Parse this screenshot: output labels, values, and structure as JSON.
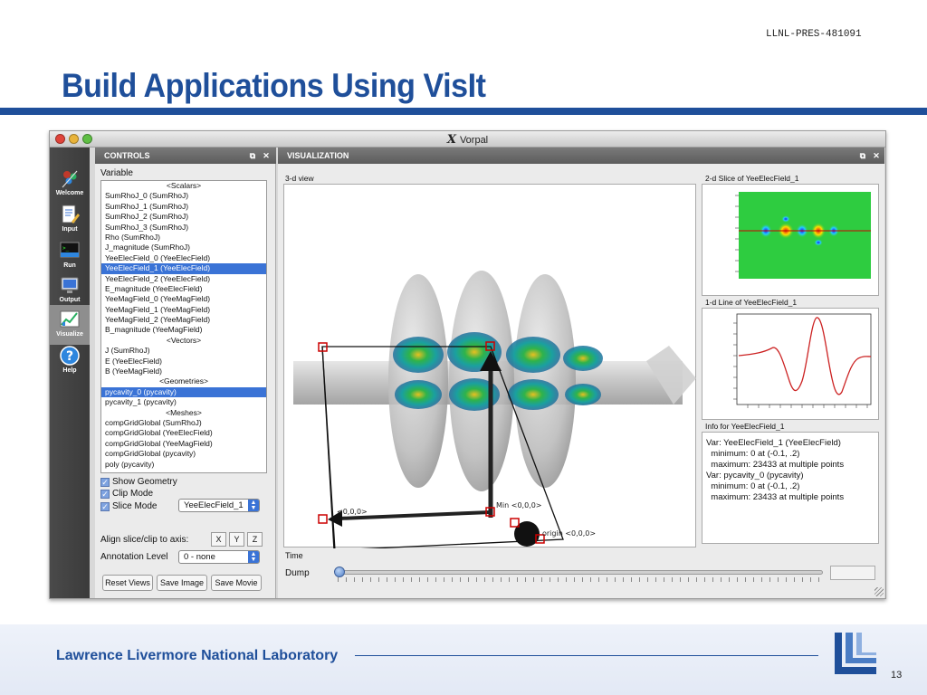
{
  "slide": {
    "pres_id": "LLNL-PRES-481091",
    "title": "Build Applications Using VisIt",
    "footer_org": "Lawrence Livermore National Laboratory",
    "page_number": "13"
  },
  "window": {
    "title": "Vorpal",
    "title_icon": "X"
  },
  "nav": {
    "items": [
      {
        "label": "Welcome",
        "icon": "welcome-icon"
      },
      {
        "label": "Input",
        "icon": "input-icon"
      },
      {
        "label": "Run",
        "icon": "run-icon"
      },
      {
        "label": "Output",
        "icon": "output-icon"
      },
      {
        "label": "Visualize",
        "icon": "visualize-icon",
        "active": true
      },
      {
        "label": "Help",
        "icon": "help-icon"
      }
    ]
  },
  "controls": {
    "header": "CONTROLS",
    "variable_label": "Variable",
    "variables": [
      {
        "text": "<Scalars>",
        "header": true
      },
      {
        "text": "SumRhoJ_0 (SumRhoJ)"
      },
      {
        "text": "SumRhoJ_1 (SumRhoJ)"
      },
      {
        "text": "SumRhoJ_2 (SumRhoJ)"
      },
      {
        "text": "SumRhoJ_3 (SumRhoJ)"
      },
      {
        "text": "Rho (SumRhoJ)"
      },
      {
        "text": "J_magnitude (SumRhoJ)"
      },
      {
        "text": "YeeElecField_0 (YeeElecField)"
      },
      {
        "text": "YeeElecField_1 (YeeElecField)",
        "selected": true
      },
      {
        "text": "YeeElecField_2 (YeeElecField)"
      },
      {
        "text": "E_magnitude (YeeElecField)"
      },
      {
        "text": "YeeMagField_0 (YeeMagField)"
      },
      {
        "text": "YeeMagField_1 (YeeMagField)"
      },
      {
        "text": "YeeMagField_2 (YeeMagField)"
      },
      {
        "text": "B_magnitude (YeeMagField)"
      },
      {
        "text": "<Vectors>",
        "header": true
      },
      {
        "text": "J (SumRhoJ)"
      },
      {
        "text": "E (YeeElecField)"
      },
      {
        "text": "B (YeeMagField)"
      },
      {
        "text": "<Geometries>",
        "header": true
      },
      {
        "text": "pycavity_0 (pycavity)",
        "selected": true
      },
      {
        "text": "pycavity_1 (pycavity)"
      },
      {
        "text": "<Meshes>",
        "header": true
      },
      {
        "text": "compGridGlobal (SumRhoJ)"
      },
      {
        "text": "compGridGlobal (YeeElecField)"
      },
      {
        "text": "compGridGlobal (YeeMagField)"
      },
      {
        "text": "compGridGlobal (pycavity)"
      },
      {
        "text": "poly (pycavity)"
      }
    ],
    "show_geometry": {
      "label": "Show Geometry",
      "checked": true
    },
    "clip_mode": {
      "label": "Clip Mode",
      "checked": true
    },
    "slice_mode": {
      "label": "Slice Mode",
      "checked": true,
      "value": "YeeElecField_1"
    },
    "align_label": "Align slice/clip to axis:",
    "axes": [
      "X",
      "Y",
      "Z"
    ],
    "annotation_label": "Annotation Level",
    "annotation_value": "0 - none",
    "buttons": {
      "reset": "Reset Views",
      "save_image": "Save Image",
      "save_movie": "Save Movie"
    }
  },
  "visualization": {
    "header": "VISUALIZATION",
    "view3d_label": "3-d view",
    "markers": {
      "min_y": "Min <0,0,0>",
      "min_x": "<0,0,0>",
      "origin": "origin <0,0,0>"
    },
    "slice_label": "2-d Slice of YeeElecField_1",
    "line_label": "1-d Line of YeeElecField_1",
    "info_label": "Info for YeeElecField_1",
    "info_lines": [
      "Var: YeeElecField_1 (YeeElecField)",
      "  minimum: 0 at (-0.1, .2)",
      "  maximum: 23433 at multiple points",
      "Var: pycavity_0 (pycavity)",
      "  minimum: 0 at (-0.1, .2)",
      "  maximum: 23433 at multiple points"
    ],
    "time_label": "Time",
    "dump_label": "Dump",
    "dump_position": 0.0
  },
  "colors": {
    "brand_blue": "#1f4f9a",
    "selection": "#3a73d6",
    "plot_red": "#cc2222"
  }
}
